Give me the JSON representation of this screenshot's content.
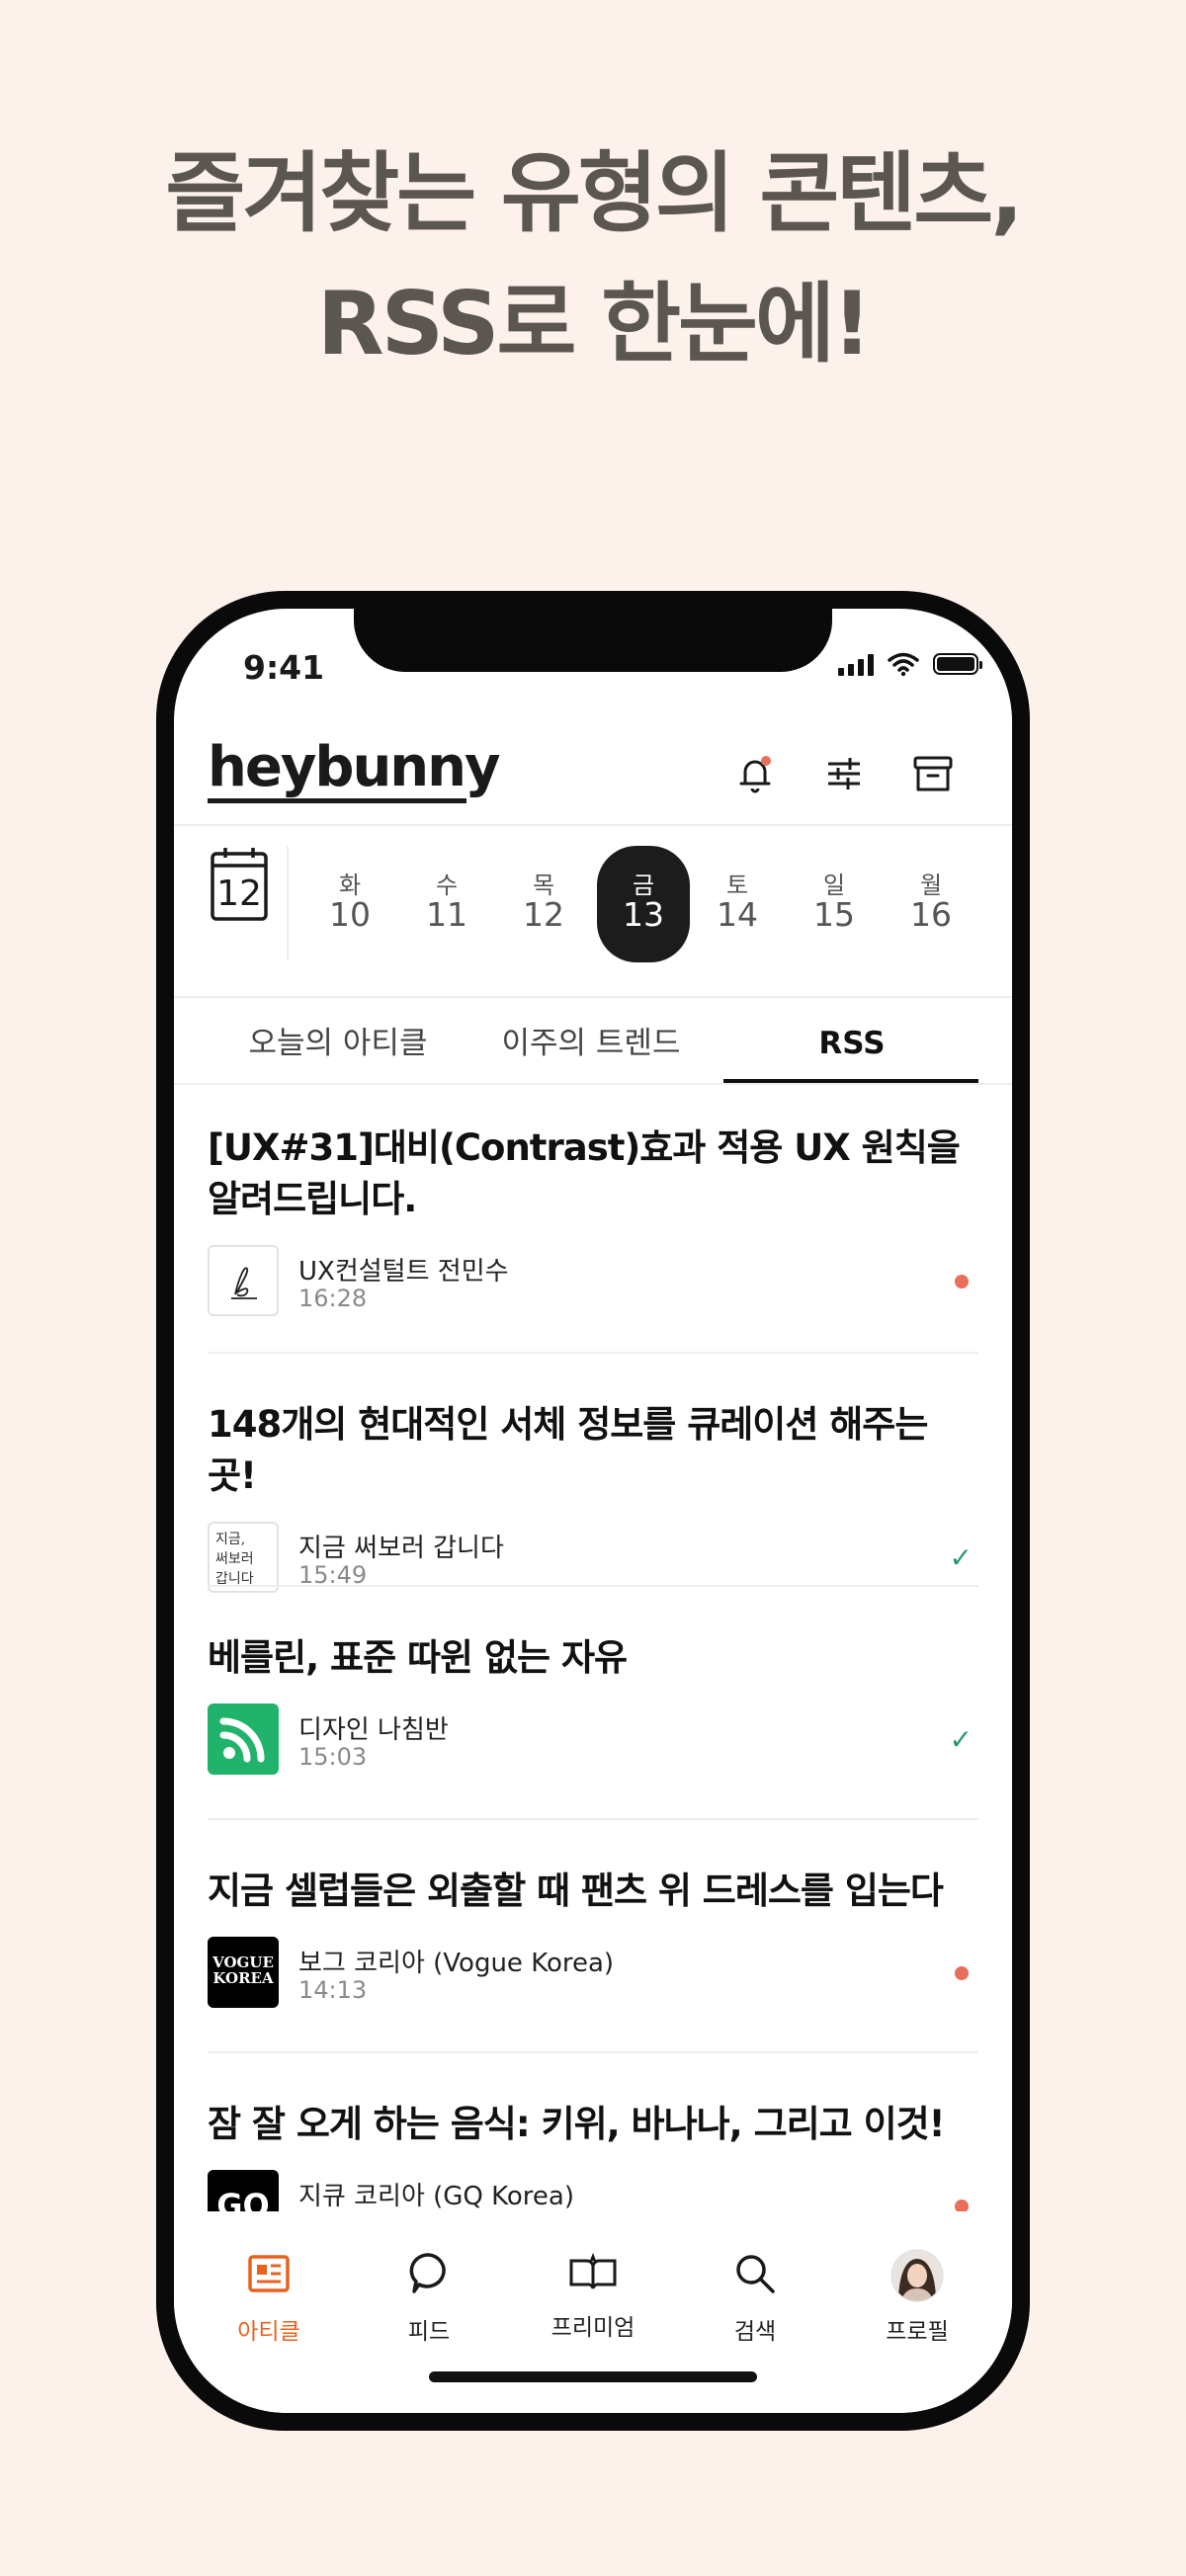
{
  "headline": {
    "line1": "즐겨찾는 유형의 콘텐츠,",
    "line2": "RSS로 한눈에!"
  },
  "status_bar": {
    "time": "9:41"
  },
  "header": {
    "logo": "heybunny",
    "icons": [
      "bell-icon",
      "sliders-icon",
      "archive-icon"
    ]
  },
  "week": {
    "calendar_day": "12",
    "days": [
      {
        "name": "화",
        "date": "10"
      },
      {
        "name": "수",
        "date": "11"
      },
      {
        "name": "목",
        "date": "12"
      },
      {
        "name": "금",
        "date": "13",
        "selected": true
      },
      {
        "name": "토",
        "date": "14"
      },
      {
        "name": "일",
        "date": "15"
      },
      {
        "name": "월",
        "date": "16"
      }
    ]
  },
  "tabs": [
    {
      "label": "오늘의 아티클"
    },
    {
      "label": "이주의 트렌드"
    },
    {
      "label": "RSS",
      "active": true
    }
  ],
  "articles": [
    {
      "title": "[UX#31]대비(Contrast)효과 적용 UX 원칙을 알려드립니다.",
      "source": "UX컨설털트 전민수",
      "time": "16:28",
      "status": "unread"
    },
    {
      "title": "148개의 현대적인 서체 정보를 큐레이션 해주는 곳!",
      "source": "지금 써보러 갑니다",
      "thumb_text": "지금,\n써보러\n갑니다",
      "time": "15:49",
      "status": "read"
    },
    {
      "title": "베를린, 표준 따윈 없는 자유",
      "source": "디자인 나침반",
      "time": "15:03",
      "status": "read"
    },
    {
      "title": "지금 셀럽들은 외출할 때 팬츠 위 드레스를 입는다",
      "source": "보그 코리아 (Vogue Korea)",
      "thumb_text": "VOGUE\nKOREA",
      "time": "14:13",
      "status": "unread"
    },
    {
      "title": "잠 잘 오게 하는 음식: 키위, 바나나, 그리고 이것!",
      "source": "지큐 코리아 (GQ Korea)",
      "thumb_text": "GQ",
      "time": "",
      "status": "unread"
    }
  ],
  "bottom_nav": [
    {
      "label": "아티클",
      "icon": "article-icon",
      "active": true
    },
    {
      "label": "피드",
      "icon": "speech-bubble-icon"
    },
    {
      "label": "프리미엄",
      "icon": "premium-book-icon"
    },
    {
      "label": "검색",
      "icon": "search-icon"
    },
    {
      "label": "프로필",
      "icon": "avatar"
    }
  ],
  "colors": {
    "background": "#fdf1eb",
    "accent": "#e8621f",
    "unread": "#e8705a",
    "read": "#2a9a6a",
    "headline": "#5b5650"
  }
}
